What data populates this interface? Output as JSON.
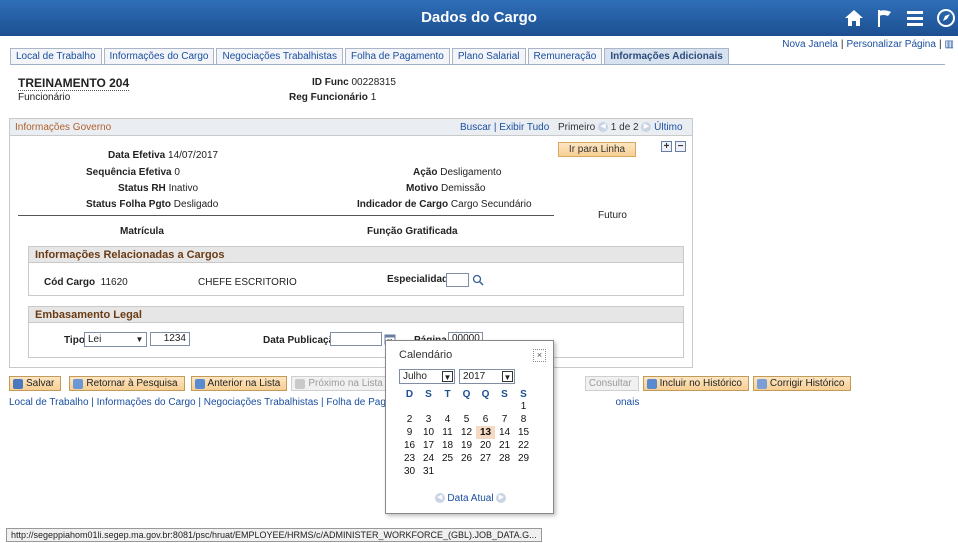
{
  "header": {
    "title": "Dados do Cargo"
  },
  "toplinks": {
    "new_window": "Nova Janela",
    "personalize": "Personalizar Página"
  },
  "tabs": [
    {
      "label": "Local de Trabalho"
    },
    {
      "label": "Informações do Cargo"
    },
    {
      "label": "Negociações Trabalhistas"
    },
    {
      "label": "Folha de Pagamento"
    },
    {
      "label": "Plano Salarial"
    },
    {
      "label": "Remuneração"
    },
    {
      "label": "Informações Adicionais"
    }
  ],
  "employee": {
    "name": "TREINAMENTO 204",
    "type": "Funcionário",
    "id_label": "ID Func",
    "id_value": "00228315",
    "reg_label": "Reg Funcionário",
    "reg_value": "1"
  },
  "section": {
    "title": "Informações Governo",
    "search": "Buscar",
    "show_all": "Exibir Tudo",
    "first": "Primeiro",
    "pager": "1 de 2",
    "last": "Último",
    "goto_button": "Ir para Linha",
    "fields": {
      "data_efetiva_label": "Data Efetiva",
      "data_efetiva": "14/07/2017",
      "seq_label": "Sequência Efetiva",
      "seq": "0",
      "acao_label": "Ação",
      "acao": "Desligamento",
      "status_rh_label": "Status RH",
      "status_rh": "Inativo",
      "motivo_label": "Motivo",
      "motivo": "Demissão",
      "status_folha_label": "Status Folha Pgto",
      "status_folha": "Desligado",
      "indicador_label": "Indicador de Cargo",
      "indicador": "Cargo Secundário",
      "futuro": "Futuro",
      "matricula": "Matrícula",
      "funcao": "Função Gratificada"
    }
  },
  "cargos": {
    "title": "Informações Relacionadas a Cargos",
    "cod_label": "Cód Cargo",
    "cod_value": "11620",
    "cargo_desc": "CHEFE ESCRITORIO",
    "esp_label": "Especialidade",
    "esp_value": ""
  },
  "legal": {
    "title": "Embasamento Legal",
    "tipo_label": "Tipo",
    "tipo_value": "Lei",
    "numero": "1234",
    "data_pub_label": "Data Publicação",
    "data_pub_value": "",
    "pagina_label": "Página",
    "pagina_value": "00000"
  },
  "toolbar": {
    "save": "Salvar",
    "return": "Retornar à Pesquisa",
    "prev": "Anterior na Lista",
    "next": "Próximo na Lista",
    "consult": "Consultar",
    "include": "Incluir no Histórico",
    "correct": "Corrigir Histórico"
  },
  "footlinks": {
    "part1": "Local de Trabalho | Informações do Cargo | Negociações Trabalhistas | Folha de Pagamento | Plan",
    "part2": "onais"
  },
  "calendar": {
    "title": "Calendário",
    "month": "Julho",
    "year": "2017",
    "weekdays": [
      "D",
      "S",
      "T",
      "Q",
      "Q",
      "S",
      "S"
    ],
    "weeks": [
      [
        "",
        "",
        "",
        "",
        "",
        "",
        "1"
      ],
      [
        "2",
        "3",
        "4",
        "5",
        "6",
        "7",
        "8"
      ],
      [
        "9",
        "10",
        "11",
        "12",
        "13",
        "14",
        "15"
      ],
      [
        "16",
        "17",
        "18",
        "19",
        "20",
        "21",
        "22"
      ],
      [
        "23",
        "24",
        "25",
        "26",
        "27",
        "28",
        "29"
      ],
      [
        "30",
        "31",
        "",
        "",
        "",
        "",
        ""
      ]
    ],
    "today": "13",
    "today_link": "Data Atual"
  },
  "status_url": "http://segeppiahom01li.segep.ma.gov.br:8081/psc/hruat/EMPLOYEE/HRMS/c/ADMINISTER_WORKFORCE_(GBL).JOB_DATA.G..."
}
